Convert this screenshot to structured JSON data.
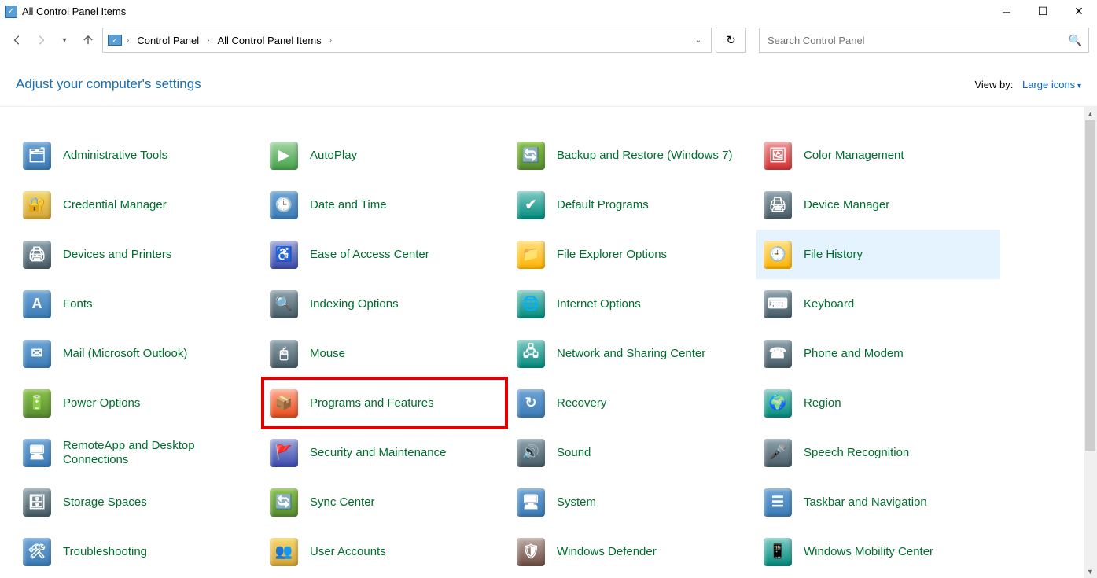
{
  "window": {
    "title": "All Control Panel Items"
  },
  "breadcrumb": {
    "root": "Control Panel",
    "current": "All Control Panel Items"
  },
  "search": {
    "placeholder": "Search Control Panel"
  },
  "subhead": {
    "title": "Adjust your computer's settings",
    "viewby_label": "View by:",
    "viewby_value": "Large icons"
  },
  "items": [
    {
      "label": "Administrative Tools",
      "icon": "admin-tools-icon",
      "glyph": "🗂",
      "cls": "c1",
      "featured": "",
      "highlighted": ""
    },
    {
      "label": "AutoPlay",
      "icon": "autoplay-icon",
      "glyph": "▶",
      "cls": "c11",
      "featured": "",
      "highlighted": ""
    },
    {
      "label": "Backup and Restore (Windows 7)",
      "icon": "backup-restore-icon",
      "glyph": "🔄",
      "cls": "c3",
      "featured": "",
      "highlighted": ""
    },
    {
      "label": "Color Management",
      "icon": "color-management-icon",
      "glyph": "🖼",
      "cls": "c12",
      "featured": "",
      "highlighted": ""
    },
    {
      "label": "Credential Manager",
      "icon": "credential-manager-icon",
      "glyph": "🔐",
      "cls": "c2",
      "featured": "",
      "highlighted": ""
    },
    {
      "label": "Date and Time",
      "icon": "date-time-icon",
      "glyph": "🕒",
      "cls": "c1",
      "featured": "",
      "highlighted": ""
    },
    {
      "label": "Default Programs",
      "icon": "default-programs-icon",
      "glyph": "✔",
      "cls": "c6",
      "featured": "",
      "highlighted": ""
    },
    {
      "label": "Device Manager",
      "icon": "device-manager-icon",
      "glyph": "🖨",
      "cls": "c9",
      "featured": "",
      "highlighted": ""
    },
    {
      "label": "Devices and Printers",
      "icon": "devices-printers-icon",
      "glyph": "🖨",
      "cls": "c9",
      "featured": "",
      "highlighted": ""
    },
    {
      "label": "Ease of Access Center",
      "icon": "ease-access-icon",
      "glyph": "♿",
      "cls": "c13",
      "featured": "",
      "highlighted": ""
    },
    {
      "label": "File Explorer Options",
      "icon": "file-explorer-options-icon",
      "glyph": "📁",
      "cls": "c10",
      "featured": "",
      "highlighted": ""
    },
    {
      "label": "File History",
      "icon": "file-history-icon",
      "glyph": "🕘",
      "cls": "c10",
      "featured": "",
      "highlighted": "highlight"
    },
    {
      "label": "Fonts",
      "icon": "fonts-icon",
      "glyph": "A",
      "cls": "c1",
      "featured": "",
      "highlighted": ""
    },
    {
      "label": "Indexing Options",
      "icon": "indexing-options-icon",
      "glyph": "🔍",
      "cls": "c9",
      "featured": "",
      "highlighted": ""
    },
    {
      "label": "Internet Options",
      "icon": "internet-options-icon",
      "glyph": "🌐",
      "cls": "c6",
      "featured": "",
      "highlighted": ""
    },
    {
      "label": "Keyboard",
      "icon": "keyboard-icon",
      "glyph": "⌨",
      "cls": "c9",
      "featured": "",
      "highlighted": ""
    },
    {
      "label": "Mail (Microsoft Outlook)",
      "icon": "mail-icon",
      "glyph": "✉",
      "cls": "c1",
      "featured": "",
      "highlighted": ""
    },
    {
      "label": "Mouse",
      "icon": "mouse-icon",
      "glyph": "🖱",
      "cls": "c9",
      "featured": "",
      "highlighted": ""
    },
    {
      "label": "Network and Sharing Center",
      "icon": "network-sharing-icon",
      "glyph": "🖧",
      "cls": "c6",
      "featured": "",
      "highlighted": ""
    },
    {
      "label": "Phone and Modem",
      "icon": "phone-modem-icon",
      "glyph": "☎",
      "cls": "c9",
      "featured": "",
      "highlighted": ""
    },
    {
      "label": "Power Options",
      "icon": "power-options-icon",
      "glyph": "🔋",
      "cls": "c3",
      "featured": "",
      "highlighted": ""
    },
    {
      "label": "Programs and Features",
      "icon": "programs-features-icon",
      "glyph": "📦",
      "cls": "c5",
      "featured": "redbox",
      "highlighted": ""
    },
    {
      "label": "Recovery",
      "icon": "recovery-icon",
      "glyph": "↻",
      "cls": "c1",
      "featured": "",
      "highlighted": ""
    },
    {
      "label": "Region",
      "icon": "region-icon",
      "glyph": "🌍",
      "cls": "c6",
      "featured": "",
      "highlighted": ""
    },
    {
      "label": "RemoteApp and Desktop Connections",
      "icon": "remoteapp-icon",
      "glyph": "🖥",
      "cls": "c1",
      "featured": "",
      "highlighted": ""
    },
    {
      "label": "Security and Maintenance",
      "icon": "security-maintenance-icon",
      "glyph": "🚩",
      "cls": "c13",
      "featured": "",
      "highlighted": ""
    },
    {
      "label": "Sound",
      "icon": "sound-icon",
      "glyph": "🔊",
      "cls": "c9",
      "featured": "",
      "highlighted": ""
    },
    {
      "label": "Speech Recognition",
      "icon": "speech-recognition-icon",
      "glyph": "🎤",
      "cls": "c9",
      "featured": "",
      "highlighted": ""
    },
    {
      "label": "Storage Spaces",
      "icon": "storage-spaces-icon",
      "glyph": "🗄",
      "cls": "c9",
      "featured": "",
      "highlighted": ""
    },
    {
      "label": "Sync Center",
      "icon": "sync-center-icon",
      "glyph": "🔄",
      "cls": "c3",
      "featured": "",
      "highlighted": ""
    },
    {
      "label": "System",
      "icon": "system-icon",
      "glyph": "🖥",
      "cls": "c1",
      "featured": "",
      "highlighted": ""
    },
    {
      "label": "Taskbar and Navigation",
      "icon": "taskbar-navigation-icon",
      "glyph": "☰",
      "cls": "c1",
      "featured": "",
      "highlighted": ""
    },
    {
      "label": "Troubleshooting",
      "icon": "troubleshooting-icon",
      "glyph": "🛠",
      "cls": "c1",
      "featured": "",
      "highlighted": ""
    },
    {
      "label": "User Accounts",
      "icon": "user-accounts-icon",
      "glyph": "👥",
      "cls": "c2",
      "featured": "",
      "highlighted": ""
    },
    {
      "label": "Windows Defender",
      "icon": "windows-defender-icon",
      "glyph": "🛡",
      "cls": "c8",
      "featured": "",
      "highlighted": ""
    },
    {
      "label": "Windows Mobility Center",
      "icon": "windows-mobility-icon",
      "glyph": "📱",
      "cls": "c6",
      "featured": "",
      "highlighted": ""
    }
  ]
}
